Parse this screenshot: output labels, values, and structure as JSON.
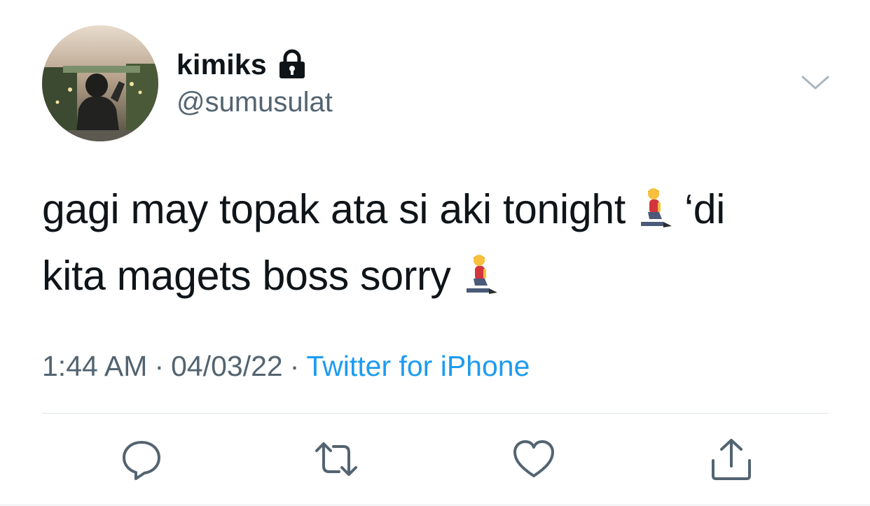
{
  "user": {
    "display_name": "kimiks",
    "handle": "@sumusulat",
    "protected": true
  },
  "tweet": {
    "line1": "gagi may topak ata si aki tonight",
    "line1_after_emoji": "‘di",
    "line2": "kita magets boss sorry",
    "emoji": "person-kneeling-emoji"
  },
  "meta": {
    "time": "1:44 AM",
    "separator": "·",
    "date": "04/03/22",
    "source": "Twitter for iPhone"
  },
  "colors": {
    "text": "#0f1419",
    "secondary": "#536471",
    "link": "#1d9bf0",
    "divider": "#dde2e6"
  },
  "icons": {
    "lock": "lock-icon",
    "more": "chevron-down-icon",
    "reply": "reply-icon",
    "retweet": "retweet-icon",
    "like": "heart-icon",
    "share": "share-icon"
  }
}
